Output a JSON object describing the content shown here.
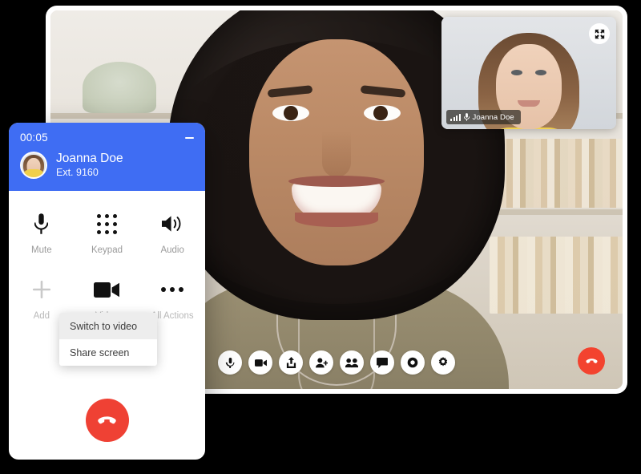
{
  "video_window": {
    "pip": {
      "expand_icon": "fullscreen-expand-icon",
      "badge_name": "Joanna Doe",
      "signal_icon": "signal-bars-icon",
      "mic_icon": "microphone-icon"
    },
    "toolbar": [
      {
        "name": "mute-mic-button",
        "icon": "microphone-icon"
      },
      {
        "name": "toggle-video-button",
        "icon": "video-camera-icon"
      },
      {
        "name": "share-button",
        "icon": "share-upload-icon"
      },
      {
        "name": "add-participant-button",
        "icon": "add-person-icon"
      },
      {
        "name": "participants-button",
        "icon": "people-icon"
      },
      {
        "name": "chat-button",
        "icon": "chat-bubble-icon"
      },
      {
        "name": "record-button",
        "icon": "record-circle-icon"
      },
      {
        "name": "settings-button",
        "icon": "gear-icon"
      }
    ],
    "end_call": {
      "name": "end-call-button",
      "icon": "hang-up-phone-icon"
    }
  },
  "dialer": {
    "timer": "00:05",
    "minimize_icon": "minimize-icon",
    "caller": {
      "name": "Joanna Doe",
      "extension": "Ext. 9160",
      "avatar": "user-avatar"
    },
    "controls_row1": [
      {
        "label": "Mute",
        "icon": "microphone-icon"
      },
      {
        "label": "Keypad",
        "icon": "keypad-dots-icon"
      },
      {
        "label": "Audio",
        "icon": "speaker-volume-icon"
      }
    ],
    "controls_row2": [
      {
        "label": "Add",
        "icon": "plus-icon"
      },
      {
        "label": "Video",
        "icon": "video-camera-icon"
      },
      {
        "label": "All Actions",
        "icon": "more-horizontal-icon"
      }
    ],
    "dropdown": {
      "items": [
        {
          "label": "Switch to video",
          "active": true
        },
        {
          "label": "Share screen",
          "active": false
        }
      ]
    },
    "end_call": {
      "icon": "hang-up-phone-icon"
    }
  },
  "colors": {
    "accent_blue": "#3F6DF3",
    "end_call_red": "#EF4134",
    "toolbar_end_call_red": "#F3432F",
    "label_gray": "#9A9A9A",
    "background": "#000000"
  }
}
